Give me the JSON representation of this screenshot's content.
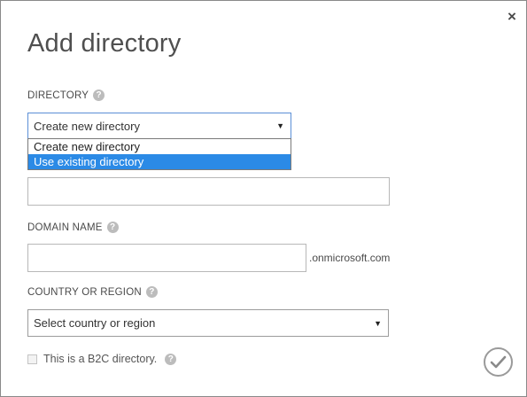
{
  "dialog": {
    "title": "Add directory",
    "close_icon": "close-icon",
    "close_glyph": "×"
  },
  "directory": {
    "label": "DIRECTORY",
    "help_glyph": "?",
    "selected": "Create new directory",
    "options": [
      "Create new directory",
      "Use existing directory"
    ],
    "highlighted_option": "Use existing directory",
    "highlight_color": "#2b8ae6"
  },
  "name_field": {
    "value": ""
  },
  "domain": {
    "label": "DOMAIN NAME",
    "help_glyph": "?",
    "value": "",
    "suffix": ".onmicrosoft.com"
  },
  "country": {
    "label": "COUNTRY OR REGION",
    "help_glyph": "?",
    "selected": "Select country or region"
  },
  "b2c": {
    "label": "This is a B2C directory.",
    "checked": false,
    "help_glyph": "?"
  },
  "confirm": {
    "icon": "checkmark-icon"
  }
}
